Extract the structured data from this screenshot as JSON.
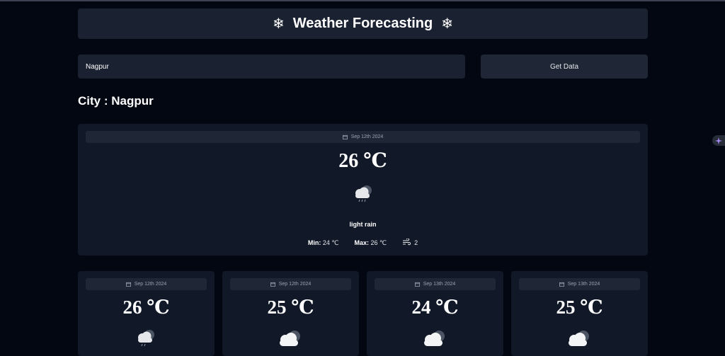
{
  "header": {
    "title": "Weather Forecasting",
    "icon": "snowflake-icon"
  },
  "search": {
    "value": "Nagpur",
    "button_label": "Get Data"
  },
  "city_heading": "City : Nagpur",
  "current": {
    "date": "Sep 12th 2024",
    "temp": "26 ℃",
    "condition": "light rain",
    "condition_icon": "rain-cloud-icon",
    "min_label": "Min:",
    "min_value": "24 ℃",
    "max_label": "Max:",
    "max_value": "26 ℃",
    "wind_icon": "wind-icon",
    "wind_value": "2"
  },
  "forecast": [
    {
      "date": "Sep 12th 2024",
      "temp": "26 ℃",
      "icon": "rain-cloud-icon"
    },
    {
      "date": "Sep 12th 2024",
      "temp": "25 ℃",
      "icon": "cloud-icon"
    },
    {
      "date": "Sep 13th 2024",
      "temp": "24 ℃",
      "icon": "cloud-icon"
    },
    {
      "date": "Sep 13th 2024",
      "temp": "25 ℃",
      "icon": "cloud-icon"
    }
  ],
  "colors": {
    "background": "#030712",
    "panel": "#111827",
    "chip": "#1f2635",
    "text": "#ffffff",
    "muted": "#9ca3af"
  }
}
